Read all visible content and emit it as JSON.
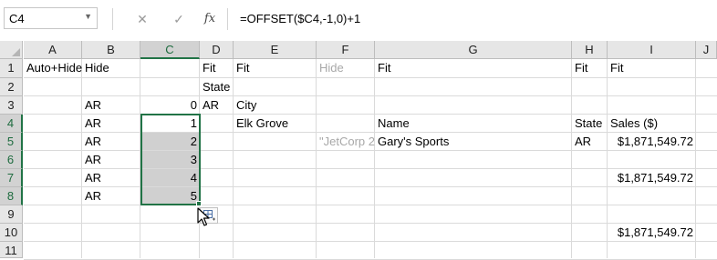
{
  "formula_bar": {
    "name_box": "C4",
    "cancel_icon": "✕",
    "enter_icon": "✓",
    "fx_label": "fx",
    "formula": "=OFFSET($C4,-1,0)+1"
  },
  "grid": {
    "columns": [
      "A",
      "B",
      "C",
      "D",
      "E",
      "F",
      "G",
      "H",
      "I",
      "J"
    ],
    "rows": [
      "1",
      "2",
      "3",
      "4",
      "5",
      "6",
      "7",
      "8",
      "9",
      "10",
      "11"
    ],
    "selected_column": "C",
    "cells": {
      "A1": "Auto+Hide",
      "B1": "Hide",
      "D1": "Fit",
      "E1": "Fit",
      "F1": "Hide",
      "G1": "Fit",
      "H1": "Fit",
      "I1": "Fit",
      "D2": "State",
      "B3": "AR",
      "C3": "0",
      "D3": "AR",
      "E3": "City",
      "B4": "AR",
      "C4": "1",
      "E4": "Elk Grove",
      "G4": "Name",
      "H4": "State",
      "I4": "Sales ($)",
      "B5": "AR",
      "C5": "2",
      "F5": "\"JetCorp 2",
      "G5": "Gary's Sports",
      "H5": "AR",
      "I5": "$1,871,549.72",
      "B6": "AR",
      "C6": "3",
      "B7": "AR",
      "C7": "4",
      "I7": "$1,871,549.72",
      "B8": "AR",
      "C8": "5",
      "I10": "$1,871,549.72"
    }
  },
  "colors": {
    "accent": "#217346",
    "selection_fill": "#d0d0d0",
    "header_bg": "#e6e6e6"
  },
  "icons": {
    "autofill_options": "autofill-options-icon",
    "cursor": "cross-arrow-cursor-icon"
  }
}
